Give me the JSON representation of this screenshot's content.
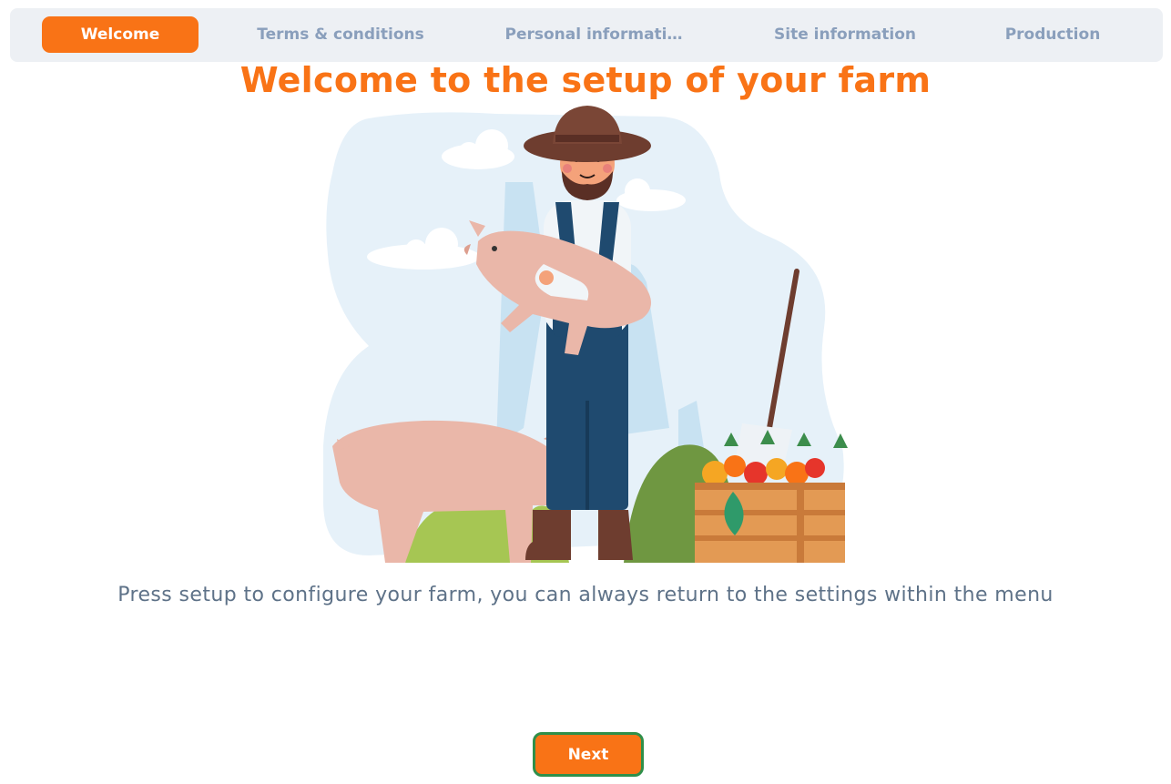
{
  "tabs": [
    {
      "label": "Welcome",
      "active": true
    },
    {
      "label": "Terms & conditions",
      "active": false
    },
    {
      "label": "Personal informati…",
      "active": false
    },
    {
      "label": "Site information",
      "active": false
    },
    {
      "label": "Production",
      "active": false
    }
  ],
  "main": {
    "title": "Welcome to the setup of your farm",
    "subtitle": "Press setup to configure your farm, you can always return to the settings within the menu",
    "illustration_icon": "farmer-with-pigs-illustration"
  },
  "footer": {
    "next_label": "Next"
  },
  "colors": {
    "accent": "#f97316",
    "tab_text": "#8a9fbc",
    "tab_bar": "#edf0f4",
    "subtitle_text": "#5e7288",
    "next_border": "#2f8f4a"
  }
}
